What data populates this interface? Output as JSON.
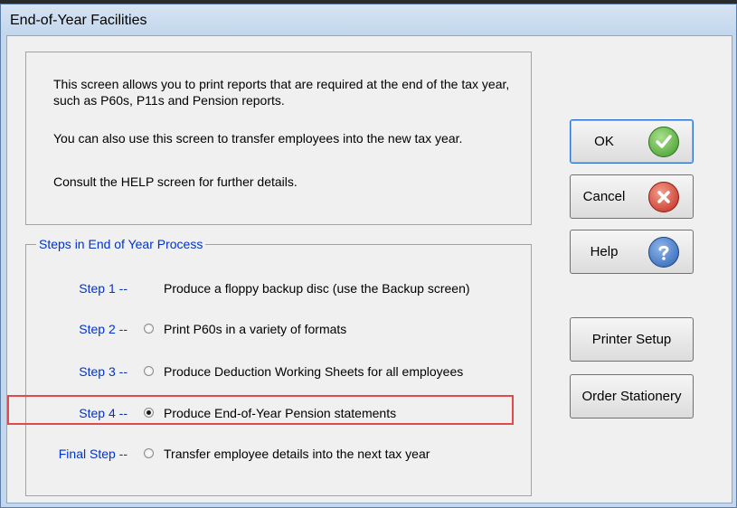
{
  "window": {
    "title": "End-of-Year Facilities"
  },
  "info": {
    "paragraph1": "This screen allows you to print reports that are required at the end of the tax year, such as P60s, P11s and Pension reports.",
    "paragraph2": "You can also use this screen to transfer employees into the new tax year.",
    "paragraph3": "Consult the HELP screen for further details."
  },
  "steps": {
    "group_title": "Steps in End of Year Process",
    "items": [
      {
        "label": "Step 1 --",
        "text": "Produce a floppy backup disc (use the Backup screen)",
        "has_radio": false,
        "checked": false
      },
      {
        "label": "Step 2 --",
        "text": "Print P60s in a variety of formats",
        "has_radio": true,
        "checked": false
      },
      {
        "label": "Step 3 --",
        "text": "Produce Deduction Working Sheets for all employees",
        "has_radio": true,
        "checked": false
      },
      {
        "label": "Step 4 --",
        "text": "Produce End-of-Year Pension statements",
        "has_radio": true,
        "checked": true
      },
      {
        "label": "Final Step --",
        "text": "Transfer employee details into the next tax year",
        "has_radio": true,
        "checked": false
      }
    ]
  },
  "buttons": {
    "ok": "OK",
    "cancel": "Cancel",
    "help": "Help",
    "printer_setup": "Printer Setup",
    "order_stationery": "Order Stationery"
  },
  "icons": {
    "ok": "check-icon",
    "cancel": "cross-icon",
    "help": "question-icon"
  },
  "colors": {
    "step_label": "#0033cc",
    "highlight": "#e04a4a"
  }
}
